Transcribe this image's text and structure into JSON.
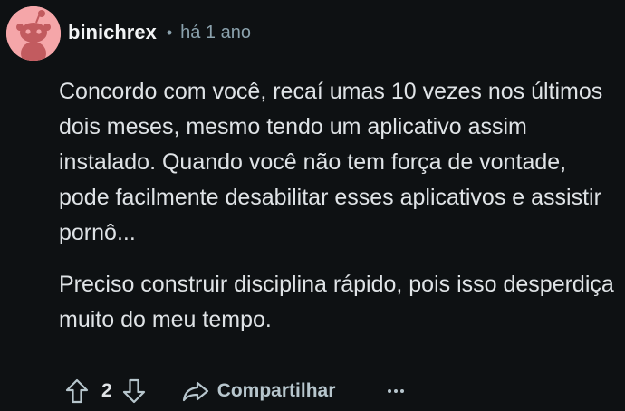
{
  "comment": {
    "author": "binichrex",
    "separator": "•",
    "timestamp": "há 1 ano",
    "paragraphs": [
      "Concordo com você, recaí umas 10 vezes nos últimos dois meses, mesmo tendo um aplicativo assim instalado. Quando você não tem força de vontade, pode facilmente desabilitar esses aplicativos e assistir pornô...",
      "Preciso construir disciplina rápido, pois isso desperdiça muito do meu tempo."
    ],
    "avatar_icon": "reddit-snoo-avatar",
    "avatar_color": "#f5a6a9"
  },
  "actions": {
    "upvote_icon": "arrow-up-icon",
    "vote_count": "2",
    "downvote_icon": "arrow-down-icon",
    "share_icon": "share-icon",
    "share_label": "Compartilhar",
    "more_icon": "ellipsis-icon"
  }
}
